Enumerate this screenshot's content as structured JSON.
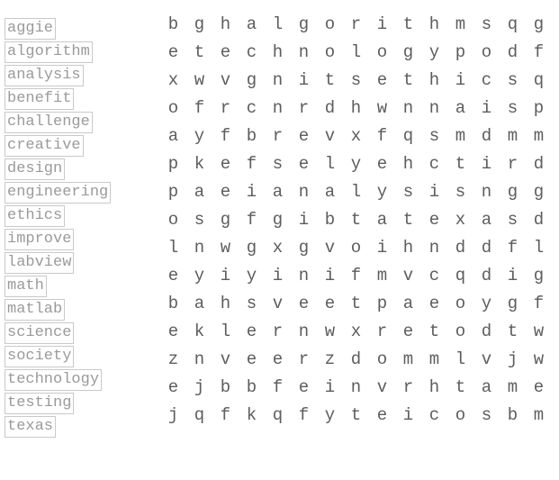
{
  "puzzle": {
    "type": "word-search",
    "word_list": [
      "aggie",
      "algorithm",
      "analysis",
      "benefit",
      "challenge",
      "creative",
      "design",
      "engineering",
      "ethics",
      "improve",
      "labview",
      "math",
      "matlab",
      "science",
      "society",
      "technology",
      "testing",
      "texas"
    ],
    "grid_rows": 15,
    "grid_cols": 15,
    "grid": [
      [
        "b",
        "g",
        "h",
        "a",
        "l",
        "g",
        "o",
        "r",
        "i",
        "t",
        "h",
        "m",
        "s",
        "q",
        "g"
      ],
      [
        "e",
        "t",
        "e",
        "c",
        "h",
        "n",
        "o",
        "l",
        "o",
        "g",
        "y",
        "p",
        "o",
        "d",
        "f"
      ],
      [
        "x",
        "w",
        "v",
        "g",
        "n",
        "i",
        "t",
        "s",
        "e",
        "t",
        "h",
        "i",
        "c",
        "s",
        "q"
      ],
      [
        "o",
        "f",
        "r",
        "c",
        "n",
        "r",
        "d",
        "h",
        "w",
        "n",
        "n",
        "a",
        "i",
        "s",
        "p"
      ],
      [
        "a",
        "y",
        "f",
        "b",
        "r",
        "e",
        "v",
        "x",
        "f",
        "q",
        "s",
        "m",
        "d",
        "m",
        "m"
      ],
      [
        "p",
        "k",
        "e",
        "f",
        "s",
        "e",
        "l",
        "y",
        "e",
        "h",
        "c",
        "t",
        "i",
        "r",
        "d"
      ],
      [
        "p",
        "a",
        "e",
        "i",
        "a",
        "n",
        "a",
        "l",
        "y",
        "s",
        "i",
        "s",
        "n",
        "g",
        "g"
      ],
      [
        "o",
        "s",
        "g",
        "f",
        "g",
        "i",
        "b",
        "t",
        "a",
        "t",
        "e",
        "x",
        "a",
        "s",
        "d"
      ],
      [
        "l",
        "n",
        "w",
        "g",
        "x",
        "g",
        "v",
        "o",
        "i",
        "h",
        "n",
        "d",
        "d",
        "f",
        "l"
      ],
      [
        "e",
        "y",
        "i",
        "y",
        "i",
        "n",
        "i",
        "f",
        "m",
        "v",
        "c",
        "q",
        "d",
        "i",
        "g"
      ],
      [
        "b",
        "a",
        "h",
        "s",
        "v",
        "e",
        "e",
        "t",
        "p",
        "a",
        "e",
        "o",
        "y",
        "g",
        "f"
      ],
      [
        "e",
        "k",
        "l",
        "e",
        "r",
        "n",
        "w",
        "x",
        "r",
        "e",
        "t",
        "o",
        "d",
        "t",
        "w"
      ],
      [
        "z",
        "n",
        "v",
        "e",
        "e",
        "r",
        "z",
        "d",
        "o",
        "m",
        "m",
        "l",
        "v",
        "j",
        "w"
      ],
      [
        "e",
        "j",
        "b",
        "b",
        "f",
        "e",
        "i",
        "n",
        "v",
        "r",
        "h",
        "t",
        "a",
        "m",
        "e"
      ],
      [
        "j",
        "q",
        "f",
        "k",
        "q",
        "f",
        "y",
        "t",
        "e",
        "i",
        "c",
        "o",
        "s",
        "b",
        "m"
      ]
    ],
    "colors": {
      "word_text": "#9a9a9a",
      "word_border": "#c9c9c9",
      "grid_text": "#5d5d5d",
      "background": "#ffffff"
    }
  }
}
